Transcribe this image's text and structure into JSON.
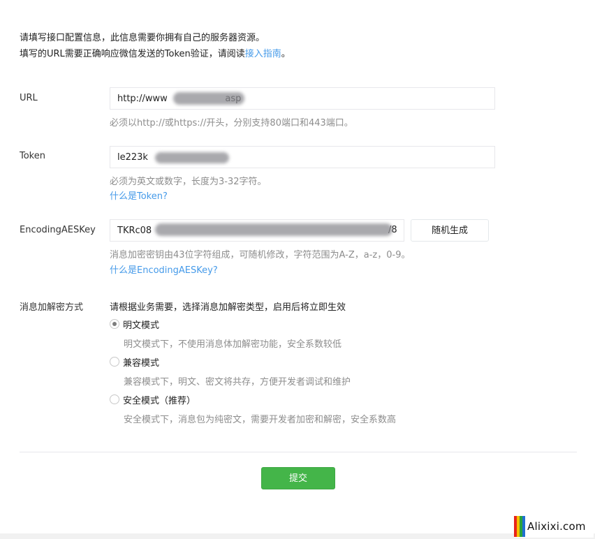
{
  "intro": {
    "line1": "请填写接口配置信息，此信息需要你拥有自己的服务器资源。",
    "line2_prefix": "填写的URL需要正确响应微信发送的Token验证，请阅读",
    "line2_link": "接入指南",
    "line2_suffix": "。"
  },
  "form": {
    "url": {
      "label": "URL",
      "value": "http://www                    asp",
      "hint": "必须以http://或https://开头，分别支持80端口和443端口。"
    },
    "token": {
      "label": "Token",
      "value": "le223k",
      "hint": "必须为英文或数字，长度为3-32字符。",
      "help_link": "什么是Token?"
    },
    "aeskey": {
      "label": "EncodingAESKey",
      "value": "TKRc08",
      "value_tail": "/8",
      "generate_button": "随机生成",
      "hint": "消息加密密钥由43位字符组成，可随机修改，字符范围为A-Z，a-z，0-9。",
      "help_link": "什么是EncodingAESKey?"
    },
    "encryption": {
      "label": "消息加解密方式",
      "instruction": "请根据业务需要，选择消息加解密类型，启用后将立即生效",
      "options": [
        {
          "label": "明文模式",
          "desc": "明文模式下，不使用消息体加解密功能，安全系数较低",
          "checked": true
        },
        {
          "label": "兼容模式",
          "desc": "兼容模式下，明文、密文将共存，方便开发者调试和维护",
          "checked": false
        },
        {
          "label": "安全模式（推荐）",
          "desc": "安全模式下，消息包为纯密文，需要开发者加密和解密，安全系数高",
          "checked": false
        }
      ]
    },
    "submit_label": "提交"
  },
  "watermark": {
    "text": "Alixixi.com",
    "bar_colors": [
      "#e8251c",
      "#f6c000",
      "#2aa33a",
      "#1f6fd1"
    ]
  },
  "colors": {
    "link": "#459ae9",
    "submit_bg": "#44b549",
    "hint": "#8d8d8d",
    "border": "#e7e7eb"
  }
}
